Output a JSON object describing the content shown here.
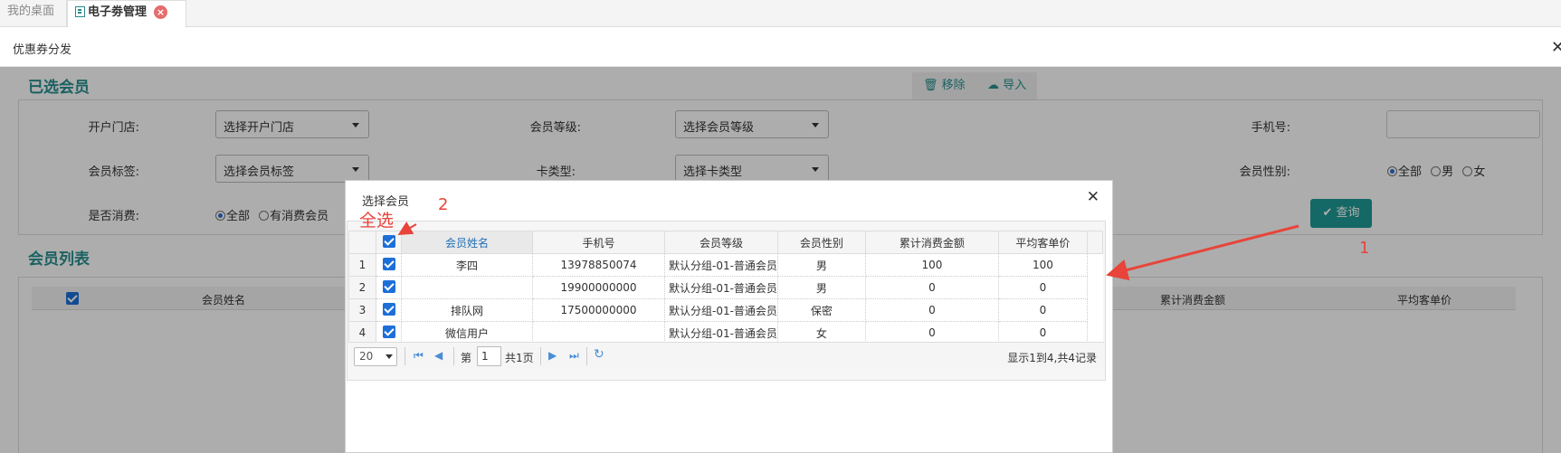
{
  "tabs": {
    "home": "我的桌面",
    "current": "电子劵管理"
  },
  "window": {
    "title": "优惠券分发"
  },
  "selected_members": {
    "title": "已选会员",
    "remove_label": "移除",
    "import_label": "导入"
  },
  "filters": {
    "store_label": "开户门店:",
    "store_value": "选择开户门店",
    "level_label": "会员等级:",
    "level_value": "选择会员等级",
    "phone_label": "手机号:",
    "tag_label": "会员标签:",
    "tag_value": "选择会员标签",
    "card_label": "卡类型:",
    "card_value": "选择卡类型",
    "gender_label": "会员性别:",
    "gender_options": [
      "全部",
      "男",
      "女"
    ],
    "consume_label": "是否消费:",
    "consume_options": [
      "全部",
      "有消费会员"
    ],
    "query_label": "查询"
  },
  "member_list": {
    "title": "会员列表",
    "columns": [
      "会员姓名",
      "累计消费金额",
      "平均客单价"
    ]
  },
  "dialog": {
    "title": "选择会员",
    "columns": [
      "会员姓名",
      "手机号",
      "会员等级",
      "会员性别",
      "累计消费金额",
      "平均客单价"
    ],
    "rows": [
      {
        "num": "1",
        "name": "李四",
        "phone": "13978850074",
        "level": "默认分组-01-普通会员",
        "gender": "男",
        "total": "100",
        "avg": "100"
      },
      {
        "num": "2",
        "name": "",
        "phone": "19900000000",
        "level": "默认分组-01-普通会员",
        "gender": "男",
        "total": "0",
        "avg": "0"
      },
      {
        "num": "3",
        "name": "排队网",
        "phone": "17500000000",
        "level": "默认分组-01-普通会员",
        "gender": "保密",
        "total": "0",
        "avg": "0"
      },
      {
        "num": "4",
        "name": "微信用户",
        "phone": "",
        "level": "默认分组-01-普通会员",
        "gender": "女",
        "total": "0",
        "avg": "0"
      }
    ],
    "pager": {
      "page_size": "20",
      "page_prefix": "第",
      "page_value": "1",
      "page_suffix": "共1页",
      "summary": "显示1到4,共4记录"
    }
  },
  "annotations": {
    "select_all": "全选",
    "num2": "2",
    "num1": "1"
  },
  "colors": {
    "accent": "#2a8f8f",
    "query_button": "#1e9a96",
    "checkbox": "#1d6fd8",
    "annotation": "#e8443a"
  }
}
